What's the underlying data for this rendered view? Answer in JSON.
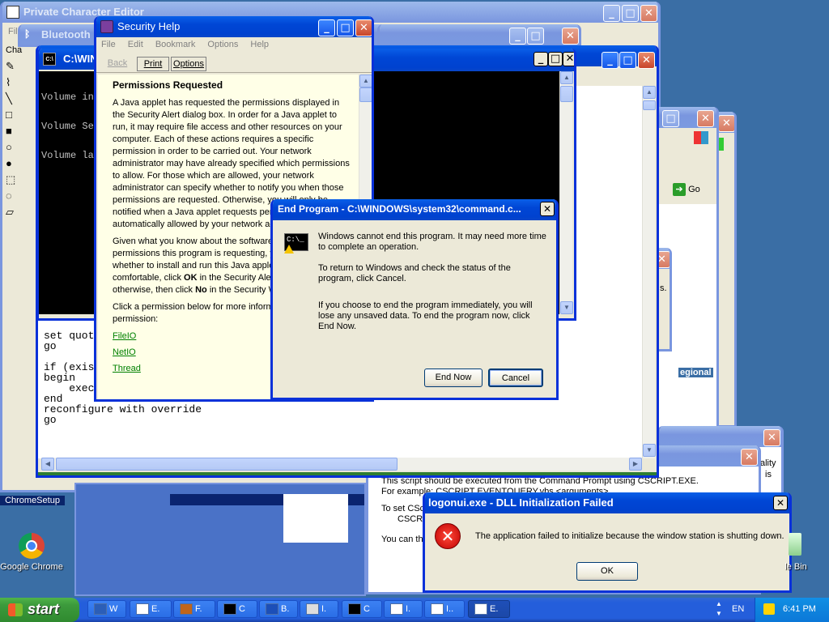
{
  "desktop": {
    "icons": [
      {
        "label": "ChromeSetup"
      },
      {
        "label": "Google Chrome"
      },
      {
        "label": "le Bin"
      }
    ]
  },
  "windows": {
    "private_char_editor": {
      "title": "Private Character Editor",
      "menu_fragment": "Fil",
      "side_label": "Cha"
    },
    "bluetooth": {
      "title": "Bluetooth F"
    },
    "cmd": {
      "title": "C:\\WINDO",
      "console_lines": [
        "Volume in",
        "Volume Se",
        "Volume la"
      ]
    },
    "editor": {
      "text": "set quot\ngo\n\nif (exis           where name = 'sp_configure'\nbegin\n    execute sp_configure 'update',1\nend\nreconfigure with override\ngo"
    },
    "ie_right": {
      "go_label": "Go",
      "regional_label": "egional",
      "side_text_1": "s.",
      "side_text_2": "ality",
      "side_text_3": "is"
    },
    "script_help": {
      "line1": "This script should be executed from the Command Prompt using CSCRIPT.EXE.",
      "line2": "For example: CSCRIPT EVENTQUERY.vbs <arguments>",
      "line3": "To set CSc",
      "line4": "CSCRI",
      "line5": "You can th"
    },
    "security_help": {
      "title": "Security Help",
      "menu": [
        "File",
        "Edit",
        "Bookmark",
        "Options",
        "Help"
      ],
      "toolbar": {
        "back": "Back",
        "print": "Print",
        "options": "Options"
      },
      "heading": "Permissions Requested",
      "para1": "A Java applet has requested the permissions displayed in the Security Alert dialog box. In order for a Java applet to run, it may require file access and other resources on your computer. Each of these actions requires a specific permission in order to be carried out. Your network administrator may have already specified which permissions to allow. For those which are allowed, your network administrator can specify whether to notify you when those permissions are requested. Otherwise, you will only be notified when a Java applet requests permissions than are automatically allowed by your network administrator.",
      "para2_a": "Given what you know about the software and the permissions this program is requesting, you must decide whether to install and run this Java applet. If you are comfortable, click ",
      "para2_ok": "OK",
      "para2_b": " in the Security Alert dialog box; otherwise, then click ",
      "para2_no": "No",
      "para2_c": " in the Security Warning dialog box.",
      "para3": "Click a permission below for more information about that permission:",
      "links": [
        "FileIO",
        "NetIO",
        "Thread"
      ]
    },
    "end_program": {
      "title": "End Program - C:\\WINDOWS\\system32\\command.c...",
      "msg1": "Windows cannot end this program. It may need more time to complete an operation.",
      "msg2": "To return to Windows and check the status of the program, click Cancel.",
      "msg3": "If you choose to end the program immediately, you will lose any unsaved data. To end the program now, click End Now.",
      "end_now": "End Now",
      "cancel": "Cancel"
    },
    "logonui": {
      "title": "logonui.exe - DLL Initialization Failed",
      "message": "The application failed to initialize because the window station is shutting down.",
      "ok": "OK"
    }
  },
  "taskbar": {
    "start": "start",
    "buttons": [
      "W",
      "E.",
      "F.",
      "C",
      "B.",
      "I.",
      "C",
      "I.",
      "I..",
      "E."
    ],
    "language": "EN",
    "clock": "6:41 PM"
  },
  "colors": {
    "desktop": "#3a6ea5",
    "titlebar": "#0046d5",
    "taskbar": "#245edb",
    "start": "#3c9a3c",
    "help_bg": "#ffffe7"
  }
}
